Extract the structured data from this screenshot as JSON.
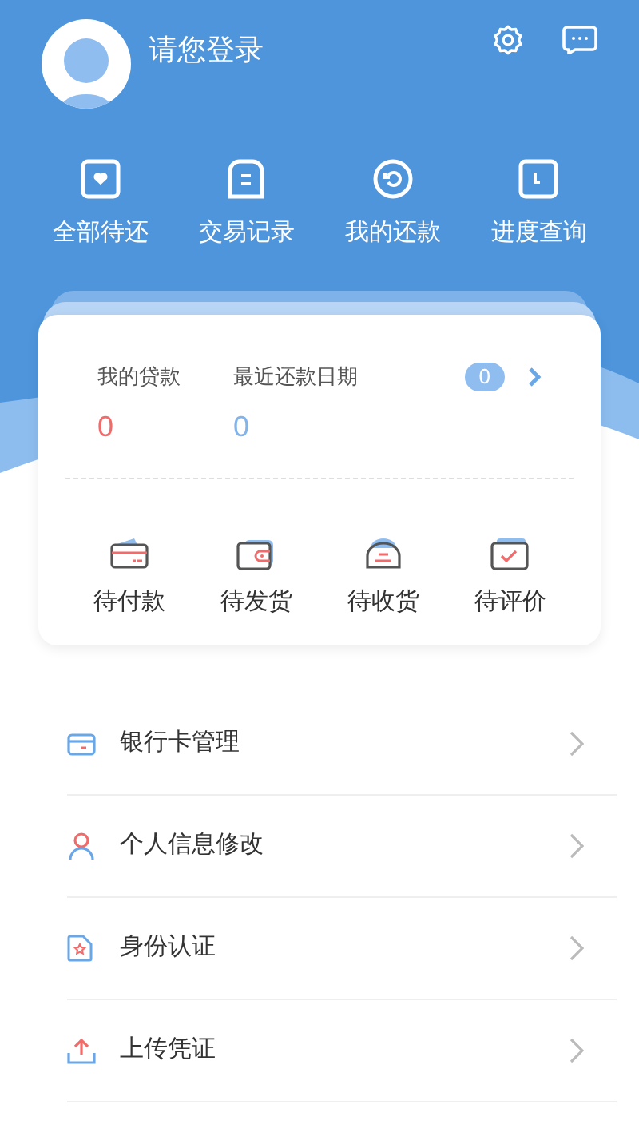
{
  "header": {
    "login_prompt": "请您登录"
  },
  "quick_actions": [
    {
      "label": "全部待还"
    },
    {
      "label": "交易记录"
    },
    {
      "label": "我的还款"
    },
    {
      "label": "进度查询"
    }
  ],
  "loan_card": {
    "loan_label": "我的贷款",
    "loan_value": "0",
    "date_label": "最近还款日期",
    "date_value": "0",
    "badge": "0",
    "orders": [
      {
        "label": "待付款"
      },
      {
        "label": "待发货"
      },
      {
        "label": "待收货"
      },
      {
        "label": "待评价"
      }
    ]
  },
  "menu": [
    {
      "label": "银行卡管理"
    },
    {
      "label": "个人信息修改"
    },
    {
      "label": "身份认证"
    },
    {
      "label": "上传凭证"
    }
  ]
}
